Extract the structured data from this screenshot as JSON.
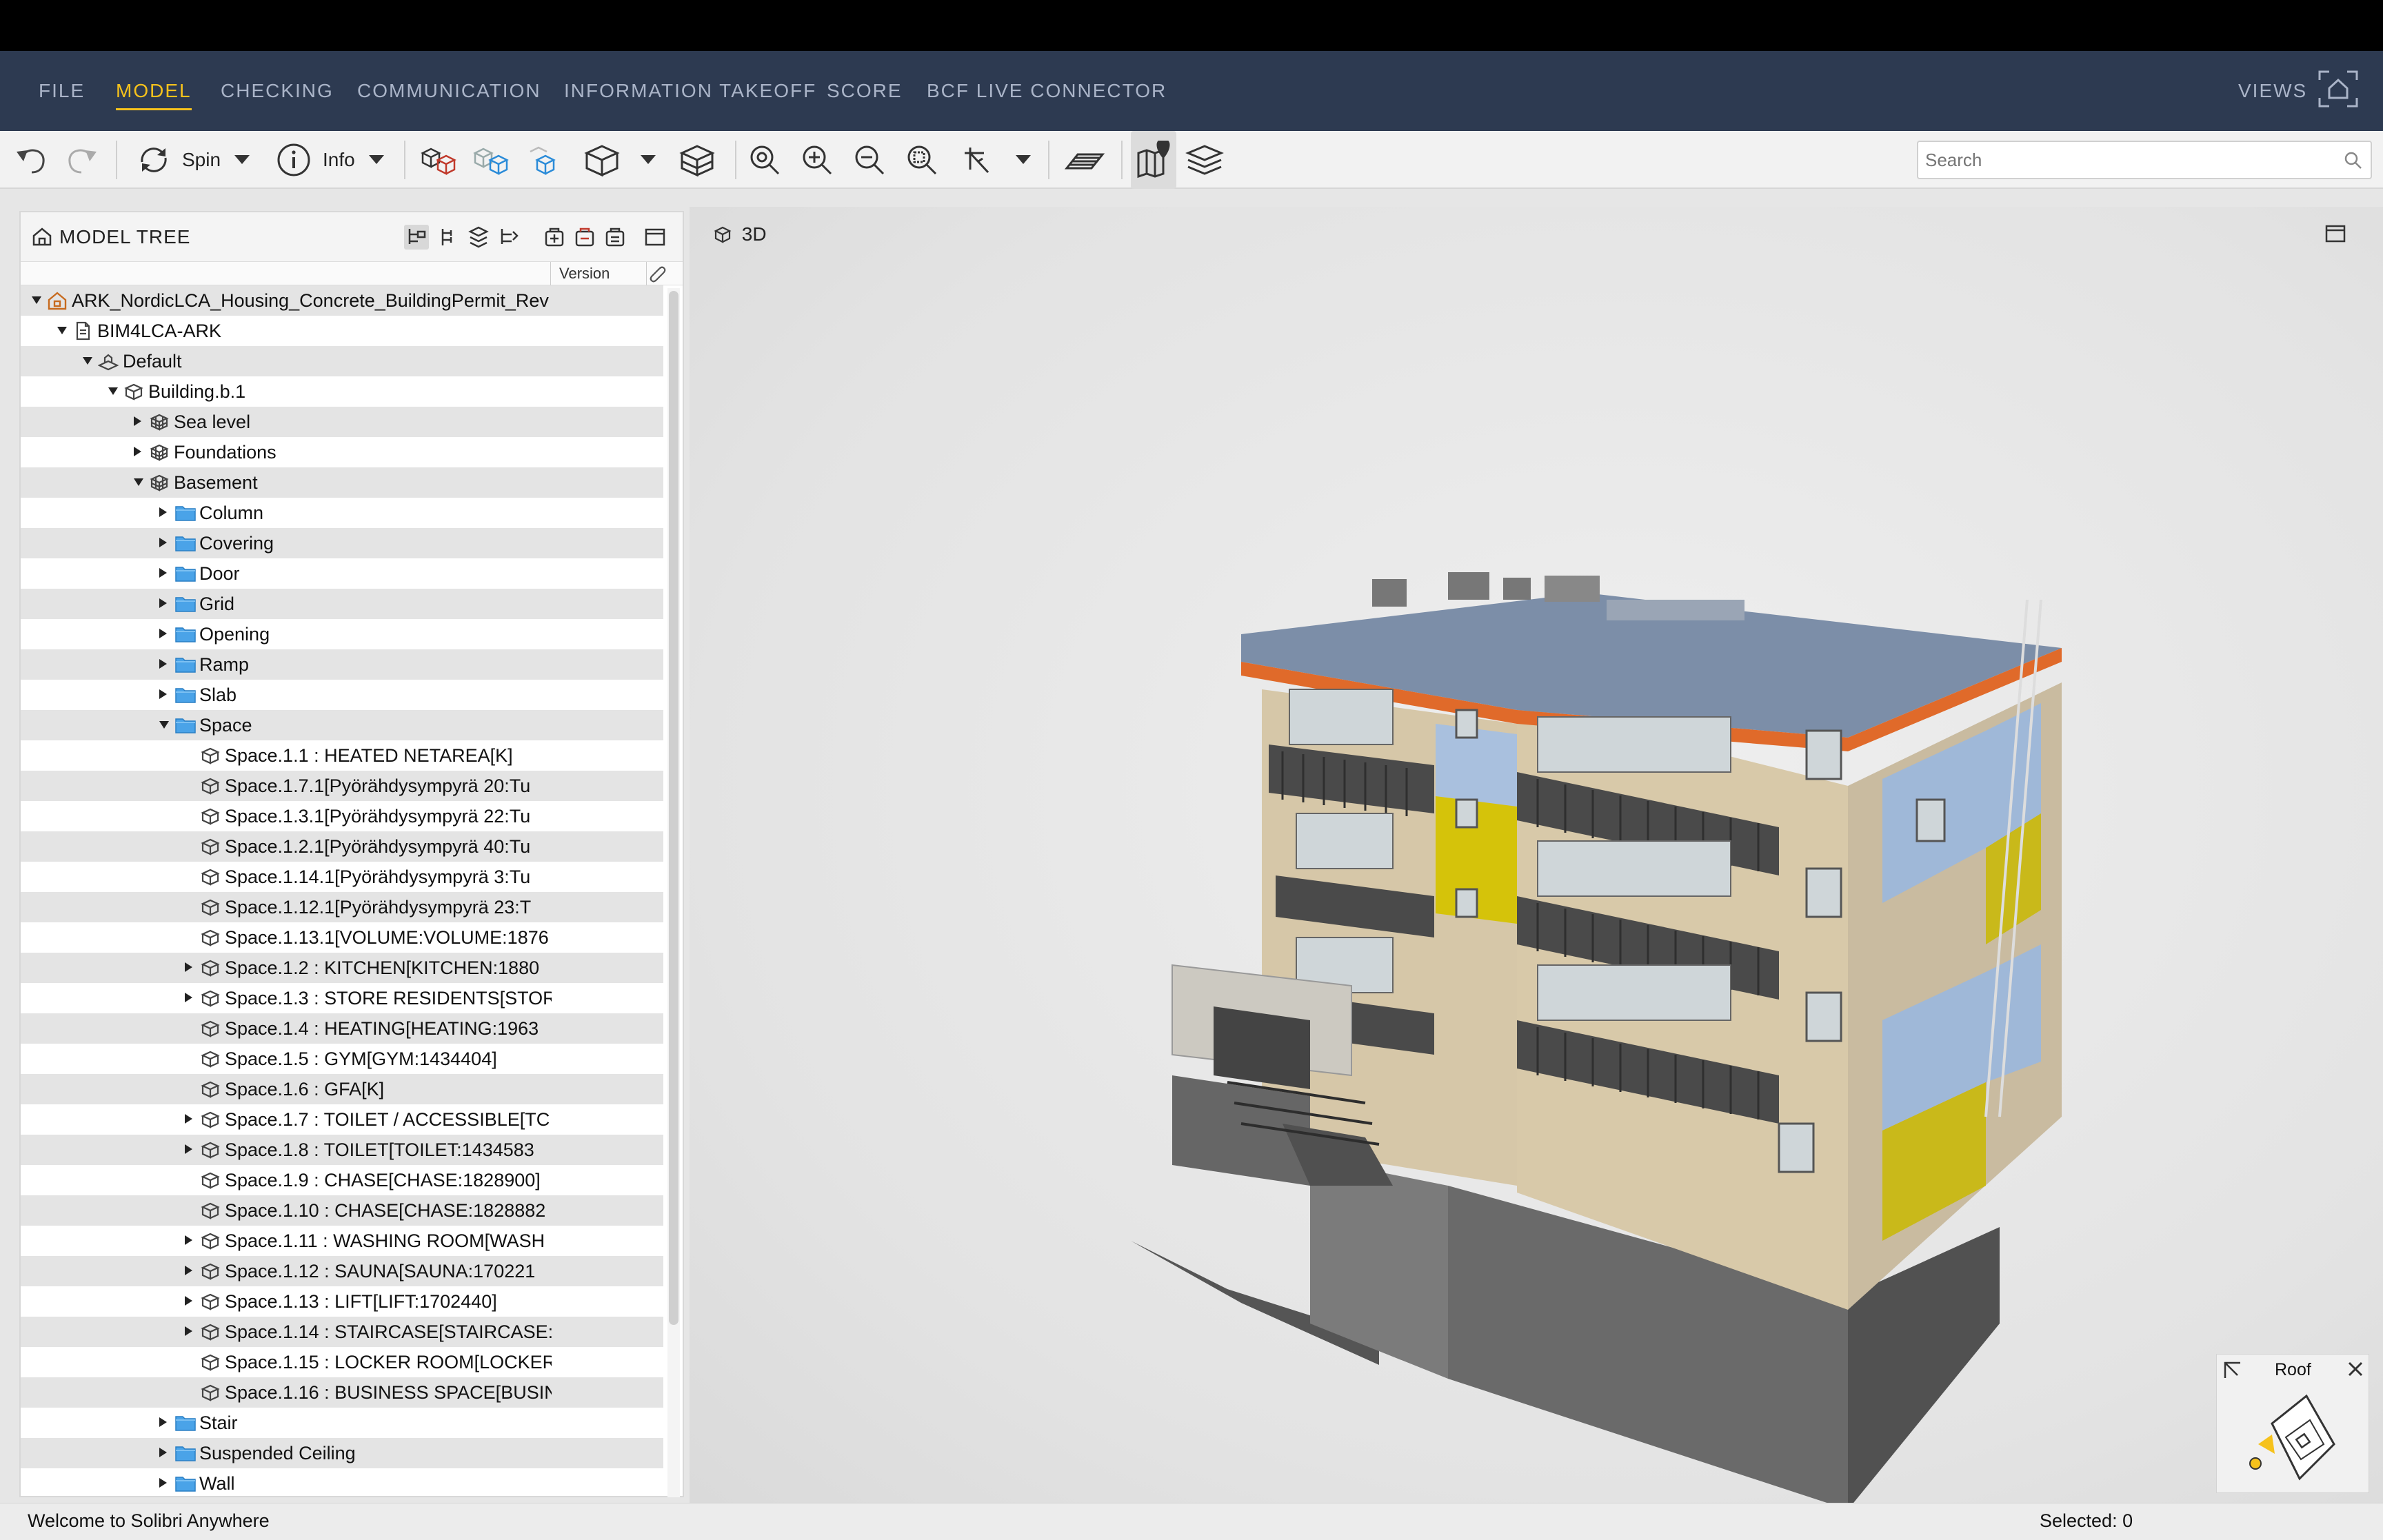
{
  "menu": {
    "items": [
      "FILE",
      "MODEL",
      "CHECKING",
      "COMMUNICATION",
      "INFORMATION TAKEOFF",
      "SCORE",
      "BCF LIVE CONNECTOR"
    ],
    "active": "MODEL",
    "views_label": "VIEWS"
  },
  "toolbar": {
    "spin_label": "Spin",
    "info_label": "Info",
    "search_placeholder": "Search"
  },
  "panel": {
    "title": "MODEL TREE",
    "version_col": "Version"
  },
  "tree": {
    "r0": "ARK_NordicLCA_Housing_Concrete_BuildingPermit_Rev",
    "r1": "BIM4LCA-ARK",
    "r2": "Default",
    "r3": "Building.b.1",
    "r4": "Sea level",
    "r5": "Foundations",
    "r6": "Basement",
    "r7": "Column",
    "r8": "Covering",
    "r9": "Door",
    "r10": "Grid",
    "r11": "Opening",
    "r12": "Ramp",
    "r13": "Slab",
    "r14": "Space",
    "r15": "Space.1.1 : HEATED NETAREA[K]",
    "r16": "Space.1.7.1[Pyörähdysympyrä 20:Tu",
    "r17": "Space.1.3.1[Pyörähdysympyrä 22:Tu",
    "r18": "Space.1.2.1[Pyörähdysympyrä 40:Tu",
    "r19": "Space.1.14.1[Pyörähdysympyrä 3:Tu",
    "r20": "Space.1.12.1[Pyörähdysympyrä 23:T",
    "r21": "Space.1.13.1[VOLUME:VOLUME:1876",
    "r22": "Space.1.2 : KITCHEN[KITCHEN:1880",
    "r23": "Space.1.3 : STORE RESIDENTS[STORI",
    "r24": "Space.1.4 : HEATING[HEATING:1963",
    "r25": "Space.1.5 : GYM[GYM:1434404]",
    "r26": "Space.1.6 : GFA[K]",
    "r27": "Space.1.7 : TOILET / ACCESSIBLE[TC",
    "r28": "Space.1.8 : TOILET[TOILET:1434583",
    "r29": "Space.1.9 : CHASE[CHASE:1828900]",
    "r30": "Space.1.10 : CHASE[CHASE:1828882",
    "r31": "Space.1.11 : WASHING ROOM[WASH",
    "r32": "Space.1.12 : SAUNA[SAUNA:170221",
    "r33": "Space.1.13 : LIFT[LIFT:1702440]",
    "r34": "Space.1.14 : STAIRCASE[STAIRCASE:",
    "r35": "Space.1.15 : LOCKER ROOM[LOCKER",
    "r36": "Space.1.16 : BUSINESS SPACE[BUSINI",
    "r37": "Stair",
    "r38": "Suspended Ceiling",
    "r39": "Wall"
  },
  "viewport": {
    "title": "3D",
    "navcube_label": "Roof"
  },
  "status": {
    "left": "Welcome to Solibri Anywhere",
    "right": "Selected: 0"
  },
  "colors": {
    "menubar": "#2d3a51",
    "menu_active": "#f6c21c",
    "menu_text": "#aab4c8"
  }
}
